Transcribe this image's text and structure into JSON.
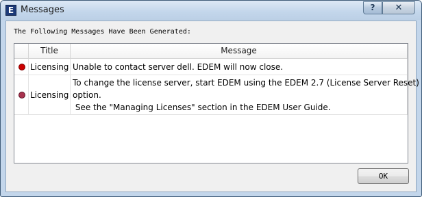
{
  "window": {
    "title": "Messages",
    "app_icon_letter": "E",
    "help_label": "?",
    "close_label": "✕"
  },
  "header_label": "The Following Messages Have Been Generated:",
  "table": {
    "columns": [
      "",
      "Title",
      "Message"
    ],
    "rows": [
      {
        "icon": "error-red-dot-icon",
        "dot_color": "#cc0000",
        "title": "Licensing",
        "message_lines": [
          "Unable to contact server dell. EDEM will now close."
        ]
      },
      {
        "icon": "error-dark-red-dot-icon",
        "dot_color": "#a8324e",
        "title": "Licensing",
        "message_lines": [
          "To change the license server, start EDEM using the EDEM 2.7 (License Server Reset)",
          "option.",
          " See the \"Managing Licenses\" section in the EDEM User Guide."
        ]
      }
    ]
  },
  "ok_label": "OK"
}
